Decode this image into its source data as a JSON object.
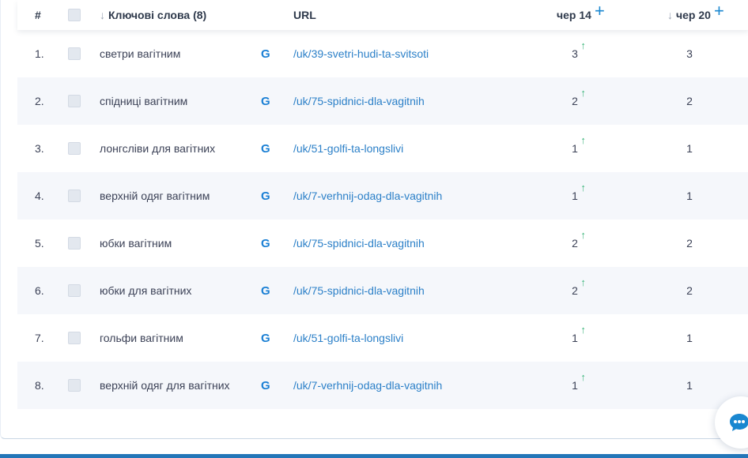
{
  "table": {
    "headers": {
      "num": "#",
      "keywords": "Ключові слова (8)",
      "url": "URL",
      "date1": "чер 14",
      "date2": "чер 20",
      "sort_icon": "arrow-down-icon",
      "add_icon": "plus-icon"
    },
    "rows": [
      {
        "num": "1.",
        "keyword": "светри вагітним",
        "engine": "G",
        "url": "/uk/39-svetri-hudi-ta-svitsoti",
        "pos1": "3",
        "pos2": "3"
      },
      {
        "num": "2.",
        "keyword": "спідниці вагітним",
        "engine": "G",
        "url": "/uk/75-spidnici-dla-vagitnih",
        "pos1": "2",
        "pos2": "2"
      },
      {
        "num": "3.",
        "keyword": "лонгсліви для вагітних",
        "engine": "G",
        "url": "/uk/51-golfi-ta-longslivi",
        "pos1": "1",
        "pos2": "1"
      },
      {
        "num": "4.",
        "keyword": "верхній одяг вагітним",
        "engine": "G",
        "url": "/uk/7-verhnij-odag-dla-vagitnih",
        "pos1": "1",
        "pos2": "1"
      },
      {
        "num": "5.",
        "keyword": "юбки вагітним",
        "engine": "G",
        "url": "/uk/75-spidnici-dla-vagitnih",
        "pos1": "2",
        "pos2": "2"
      },
      {
        "num": "6.",
        "keyword": "юбки для вагітних",
        "engine": "G",
        "url": "/uk/75-spidnici-dla-vagitnih",
        "pos1": "2",
        "pos2": "2"
      },
      {
        "num": "7.",
        "keyword": "гольфи вагітним",
        "engine": "G",
        "url": "/uk/51-golfi-ta-longslivi",
        "pos1": "1",
        "pos2": "1"
      },
      {
        "num": "8.",
        "keyword": "верхній одяг для вагітних",
        "engine": "G",
        "url": "/uk/7-verhnij-odag-dla-vagitnih",
        "pos1": "1",
        "pos2": "1"
      }
    ]
  },
  "icons": {
    "engine": "google-icon",
    "trend": "arrow-up-icon",
    "chat": "chat-bubble-icon"
  },
  "colors": {
    "accent": "#1a87d0",
    "link": "#2c80c8",
    "trend_up": "#3bb57a",
    "row_alt": "#f5f7fb"
  }
}
